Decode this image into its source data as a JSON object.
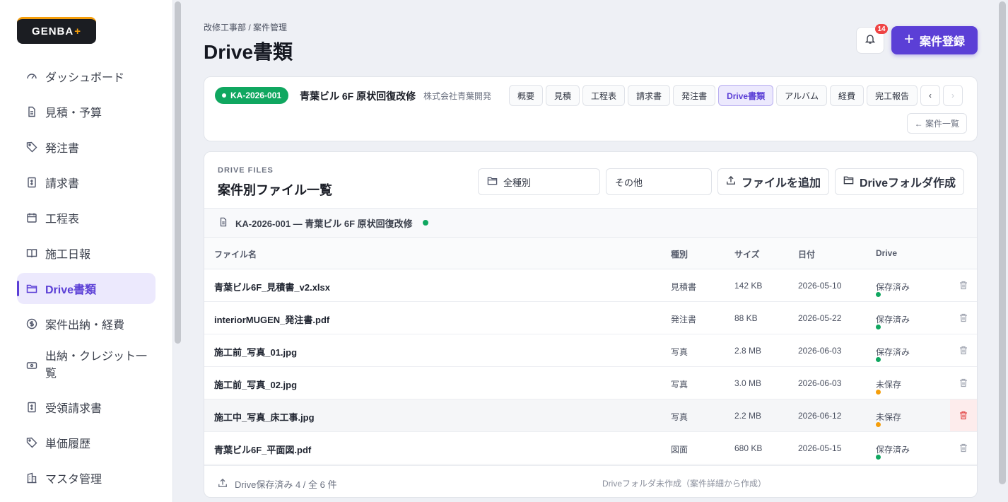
{
  "brand": {
    "name": "GENBA",
    "mark": "+"
  },
  "sidebar": {
    "items": [
      {
        "label": "ダッシュボード",
        "icon": "gauge-icon"
      },
      {
        "label": "見積・予算",
        "icon": "document-icon"
      },
      {
        "label": "発注書",
        "icon": "tag-icon"
      },
      {
        "label": "請求書",
        "icon": "receipt-icon"
      },
      {
        "label": "工程表",
        "icon": "calendar-icon"
      },
      {
        "label": "施工日報",
        "icon": "book-icon"
      },
      {
        "label": "Drive書類",
        "icon": "folder-icon",
        "active": true
      },
      {
        "label": "案件出納・経費",
        "icon": "dollar-icon"
      },
      {
        "label": "出納・クレジット一覧",
        "icon": "card-icon"
      },
      {
        "label": "受領請求書",
        "icon": "receipt-icon"
      },
      {
        "label": "単価履歴",
        "icon": "tag-icon"
      },
      {
        "label": "マスタ管理",
        "icon": "building-icon"
      }
    ]
  },
  "header": {
    "breadcrumb": "改修工事部 / 案件管理",
    "title": "Drive書類",
    "notifications": "14",
    "new_button": "案件登録"
  },
  "project": {
    "code": "KA-2026-001",
    "name": "青葉ビル 6F 原状回復改修",
    "client": "株式会社青葉開発",
    "tabs": [
      "概要",
      "見積",
      "工程表",
      "請求書",
      "発注書",
      "Drive書類",
      "アルバム",
      "経費",
      "完工報告"
    ],
    "active_tab": "Drive書類",
    "back_label": "← 案件一覧"
  },
  "files": {
    "eyebrow": "DRIVE FILES",
    "title": "案件別ファイル一覧",
    "filter_type": "全種別",
    "filter_other": "その他",
    "add_button": "ファイルを追加",
    "folder_button": "Driveフォルダ作成",
    "group_label": "KA-2026-001 — 青葉ビル 6F 原状回復改修",
    "columns": {
      "name": "ファイル名",
      "kind": "種別",
      "size": "サイズ",
      "date": "日付",
      "drive": "Drive"
    },
    "rows": [
      {
        "name": "青葉ビル6F_見積書_v2.xlsx",
        "kind": "見積書",
        "size": "142 KB",
        "date": "2026-05-10",
        "status": "保存済み",
        "saved": true
      },
      {
        "name": "interiorMUGEN_発注書.pdf",
        "kind": "発注書",
        "size": "88 KB",
        "date": "2026-05-22",
        "status": "保存済み",
        "saved": true
      },
      {
        "name": "施工前_写真_01.jpg",
        "kind": "写真",
        "size": "2.8 MB",
        "date": "2026-06-03",
        "status": "保存済み",
        "saved": true
      },
      {
        "name": "施工前_写真_02.jpg",
        "kind": "写真",
        "size": "3.0 MB",
        "date": "2026-06-03",
        "status": "未保存",
        "saved": false
      },
      {
        "name": "施工中_写真_床工事.jpg",
        "kind": "写真",
        "size": "2.2 MB",
        "date": "2026-06-12",
        "status": "未保存",
        "saved": false,
        "hover": true
      },
      {
        "name": "青葉ビル6F_平面図.pdf",
        "kind": "図面",
        "size": "680 KB",
        "date": "2026-05-15",
        "status": "保存済み",
        "saved": true
      }
    ],
    "footer_left": "Drive保存済み 4 / 全 6 件",
    "footer_right": "Driveフォルダ未作成（案件詳細から作成）"
  },
  "colors": {
    "accent": "#5b3fd6",
    "saved": "#10a760",
    "unsaved": "#f59e0b",
    "danger": "#e24545"
  }
}
